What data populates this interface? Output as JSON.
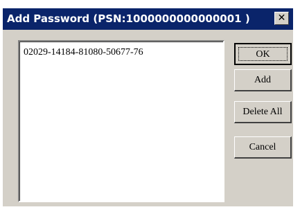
{
  "window": {
    "title": "Add Password (PSN:1000000000000001 )",
    "close_glyph": "✕"
  },
  "list": {
    "items": [
      "02029-14184-81080-50677-76"
    ]
  },
  "buttons": {
    "ok": "OK",
    "add": "Add",
    "delete_all": "Delete All",
    "cancel": "Cancel"
  },
  "colors": {
    "titlebar": "#0a246a",
    "face": "#d4d0c8"
  }
}
